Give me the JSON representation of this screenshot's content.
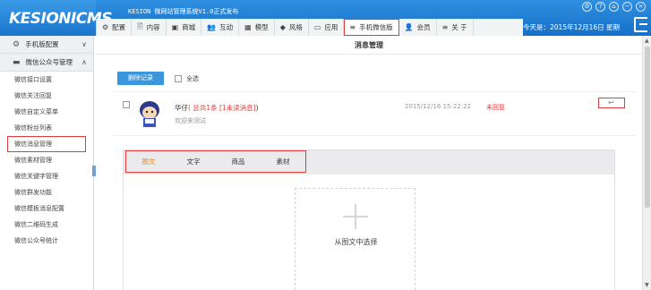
{
  "header": {
    "logo": "KESIONICMS",
    "title": "KESION 微网站管理系统V1.0正式发布",
    "title_badge": "",
    "today_label": "今天是：2015年12月16日 星期",
    "system_icons": [
      "settings-icon",
      "help-icon",
      "home-icon",
      "minimize-icon",
      "close-icon"
    ]
  },
  "topnav": {
    "items": [
      {
        "icon": "⚙",
        "label": "配置"
      },
      {
        "icon": "🖹",
        "label": "内容"
      },
      {
        "icon": "▣",
        "label": "商城"
      },
      {
        "icon": "👥",
        "label": "互动"
      },
      {
        "icon": "▦",
        "label": "模型"
      },
      {
        "icon": "◆",
        "label": "风格"
      },
      {
        "icon": "▭",
        "label": "应用"
      },
      {
        "icon": "≡",
        "label": "手机微信版"
      },
      {
        "icon": "👤",
        "label": "会员"
      },
      {
        "icon": "≡",
        "label": "关 于"
      }
    ]
  },
  "sidebar": {
    "section1": {
      "label": "手机版配置",
      "icon": "⚙",
      "chevron": "∨"
    },
    "section2": {
      "label": "微信公众号管理",
      "icon": "▬",
      "chevron": "∧"
    },
    "items": [
      "微信接口设置",
      "微信关注回复",
      "微信自定义菜单",
      "微信粉丝列表",
      "微信消息管理",
      "微信素材管理",
      "微信关键字管理",
      "微信群发功能",
      "微信模板消息配置",
      "微信二维码生成",
      "微信公众号统计"
    ]
  },
  "main": {
    "page_title": "消息管理",
    "delete_button": "删除记录",
    "select_all": "全选",
    "message": {
      "name": "华仔",
      "count_text": "( 总共1条 [1未读消息]",
      "close_paren": ")",
      "text": "欢迎来测试",
      "time": "2015/12/16 15:22:22",
      "status": "未回复"
    },
    "editor": {
      "tabs": [
        "图文",
        "文字",
        "商品",
        "素材"
      ],
      "picker_label": "从图文中选择"
    }
  },
  "colors": {
    "accent": "#1670c8",
    "highlight": "#e23b3b",
    "active_tab": "#e0892b",
    "button": "#3c96dc"
  }
}
